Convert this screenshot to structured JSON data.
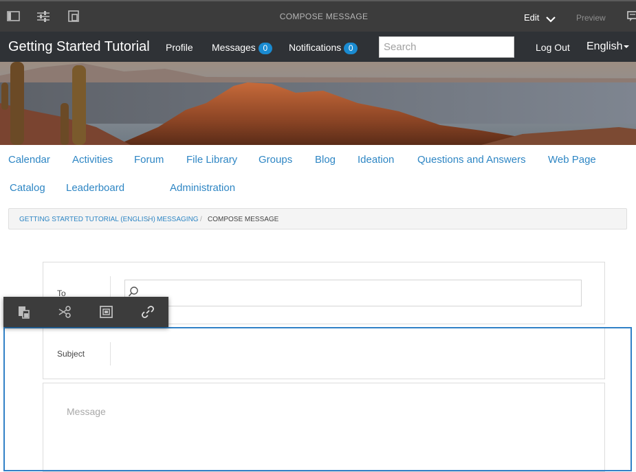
{
  "editor": {
    "title": "COMPOSE MESSAGE",
    "mode": "Edit",
    "preview": "Preview",
    "icons": [
      "side-panel-icon",
      "properties-icon",
      "emulator-icon",
      "chevron-down-icon",
      "annotation-icon"
    ]
  },
  "header": {
    "site_title": "Getting Started Tutorial",
    "profile": "Profile",
    "messages": "Messages",
    "messages_count": "0",
    "notifications": "Notifications",
    "notifications_count": "0",
    "search_placeholder": "Search",
    "logout": "Log Out",
    "language": "English",
    "badge_color": "#1a8bd1"
  },
  "nav": {
    "items": [
      "Calendar",
      "Activities",
      "Forum",
      "File Library",
      "Groups",
      "Blog",
      "Ideation",
      "Questions and Answers",
      "Web Page",
      "Catalog",
      "Leaderboard",
      "Administration"
    ],
    "link_color": "#2e86c4"
  },
  "breadcrumb": {
    "items": [
      "GETTING STARTED TUTORIAL (ENGLISH)",
      "MESSAGING",
      "COMPOSE MESSAGE"
    ],
    "separator": "/"
  },
  "toolbar": {
    "icons": [
      "paste-icon",
      "cut-icon",
      "insert-icon",
      "link-icon"
    ]
  },
  "form": {
    "to_label": "To",
    "subject_label": "Subject",
    "message_placeholder": "Message"
  },
  "colors": {
    "selection_outline": "#2f80c6",
    "toolbar_bg": "#3c3c3c"
  }
}
